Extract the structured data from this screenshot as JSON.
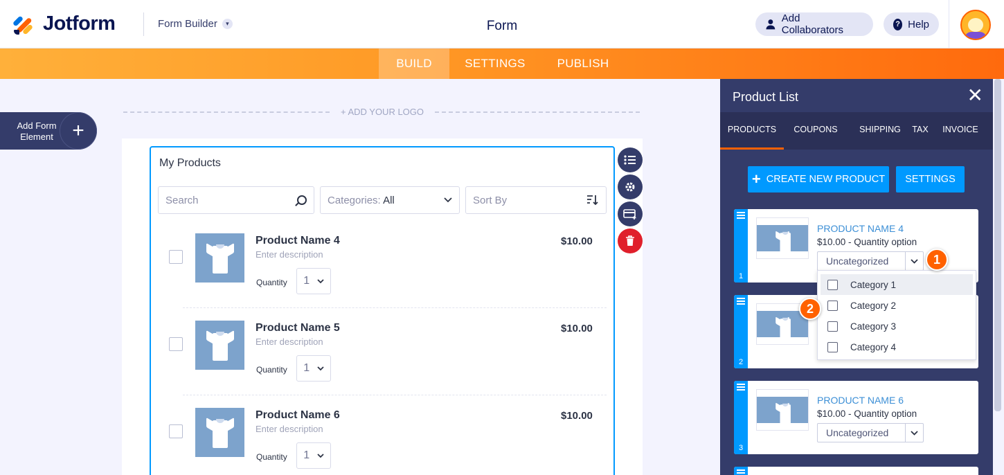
{
  "header": {
    "logo_text": "Jotform",
    "builder_label": "Form Builder",
    "form_title": "Form",
    "collaborators_label": "Add Collaborators",
    "help_label": "Help",
    "help_icon_glyph": "?"
  },
  "nav": {
    "tabs": [
      {
        "label": "BUILD",
        "active": true
      },
      {
        "label": "SETTINGS",
        "active": false
      },
      {
        "label": "PUBLISH",
        "active": false
      }
    ]
  },
  "left": {
    "add_element_label": "Add Form Element",
    "add_logo_label": "+ ADD YOUR LOGO"
  },
  "products_widget": {
    "title": "My Products",
    "search_placeholder": "Search",
    "categories_label": "Categories:",
    "categories_value": "All",
    "sort_label": "Sort By",
    "quantity_label": "Quantity",
    "products": [
      {
        "name": "Product Name 4",
        "description": "Enter description",
        "price": "$10.00",
        "quantity": "1"
      },
      {
        "name": "Product Name 5",
        "description": "Enter description",
        "price": "$10.00",
        "quantity": "1"
      },
      {
        "name": "Product Name 6",
        "description": "Enter description",
        "price": "$10.00",
        "quantity": "1"
      }
    ]
  },
  "panel": {
    "title": "Product List",
    "tabs": [
      "PRODUCTS",
      "COUPONS",
      "SHIPPING",
      "TAX",
      "INVOICE"
    ],
    "create_button": "CREATE NEW PRODUCT",
    "settings_button": "SETTINGS",
    "cards": [
      {
        "num": "1",
        "name": "PRODUCT NAME 4",
        "sub": "$10.00 - Quantity option",
        "category": "Uncategorized"
      },
      {
        "num": "2",
        "name": "",
        "sub": "",
        "category": ""
      },
      {
        "num": "3",
        "name": "PRODUCT NAME 6",
        "sub": "$10.00 - Quantity option",
        "category": "Uncategorized"
      }
    ],
    "category_options": [
      "Category 1",
      "Category 2",
      "Category 3",
      "Category 4"
    ]
  },
  "callouts": [
    "1",
    "2"
  ],
  "colors": {
    "brand_navy": "#0a1551",
    "accent_orange": "#ff6100",
    "accent_blue": "#0099ff",
    "panel_bg": "#343c6a"
  }
}
